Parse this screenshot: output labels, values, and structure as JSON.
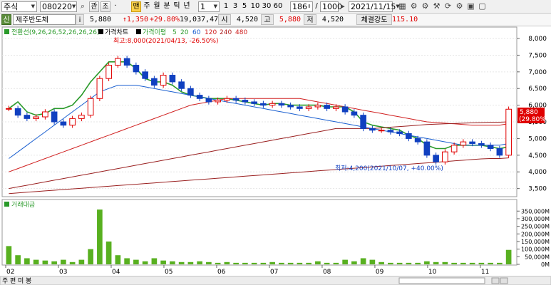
{
  "toolbar": {
    "market_select": "주식",
    "code_input": "080220",
    "btn_gwan": "관",
    "btn_jo": "조",
    "btn_yellow": "맨",
    "period_labels": [
      "주",
      "월",
      "분",
      "틱",
      "년"
    ],
    "interval_select": "1",
    "minute_buttons": [
      "1",
      "3",
      "5",
      "10",
      "30",
      "60"
    ],
    "count_input": "186",
    "total_input": "1000",
    "date_select": "2021/11/15"
  },
  "info": {
    "badge": "신",
    "name": "제주반도체",
    "info_icon": "i",
    "price": "5,880",
    "change": "↑1,350",
    "change_rate": "+29.80%",
    "volume": "19,037,471",
    "open_label": "시",
    "open": "4,520",
    "high_label": "고",
    "high": "5,880",
    "low_label": "저",
    "low": "4,520",
    "strength_label": "체결강도",
    "strength": "115.10"
  },
  "price_panel": {
    "legend_ichimoku": "전환선(9,26,26,52,26,26,26)",
    "legend_price": "가격차트",
    "legend_ma": "가격이평",
    "ma_periods": [
      "5",
      "20",
      "60",
      "120",
      "240",
      "480"
    ],
    "ma_colors": [
      "#2a9a2a",
      "#2a9a2a",
      "#1a5fd0",
      "#d02020",
      "#b02020",
      "#d02020"
    ],
    "high_annotation": "최고:8,000(2021/04/13, -26.50%)",
    "low_annotation": "최저:4,200(2021/10/07, +40.00%)",
    "last_price_tag": "5,880",
    "last_rate_tag": "(29.80%)",
    "y_ticks": [
      "8,000",
      "7,500",
      "7,000",
      "6,500",
      "6,000",
      "5,500",
      "5,000",
      "4,500",
      "4,000",
      "3,500"
    ]
  },
  "volume_panel": {
    "legend": "거래대금",
    "y_ticks": [
      "350,000M",
      "300,000M",
      "250,000M",
      "200,000M",
      "150,000M",
      "100,000M",
      "50,000M",
      "0M"
    ]
  },
  "x_axis": {
    "labels": [
      "02",
      "03",
      "04",
      "05",
      "06",
      "07",
      "08",
      "09",
      "10",
      "11"
    ]
  },
  "bottom_bar": {
    "tabs": [
      "주",
      "편",
      "미",
      "봉"
    ]
  },
  "colors": {
    "up": "#e00000",
    "down": "#1040c0",
    "conversion_line": "#2a9a2a",
    "ma60": "#1a5fd0",
    "ma120": "#d02020",
    "ma240": "#9a2020"
  },
  "chart_data": {
    "type": "candlestick",
    "x_labels": [
      "02",
      "03",
      "04",
      "05",
      "06",
      "07",
      "08",
      "09",
      "10",
      "11"
    ],
    "ylim": [
      3300,
      8300
    ],
    "close_path": [
      5900,
      5700,
      5600,
      5650,
      5800,
      5500,
      5400,
      5600,
      5700,
      6200,
      6800,
      7200,
      7400,
      7200,
      7000,
      6800,
      6600,
      6900,
      6700,
      6500,
      6300,
      6200,
      6100,
      6150,
      6200,
      6150,
      6100,
      6050,
      6000,
      6050,
      6000,
      5950,
      5900,
      5950,
      6000,
      5900,
      5950,
      5800,
      5700,
      5300,
      5250,
      5250,
      5200,
      5150,
      5000,
      4900,
      4500,
      4300,
      4600,
      4800,
      4900,
      4850,
      4800,
      4700,
      4500,
      5880
    ],
    "series": [
      {
        "name": "전환선",
        "values": [
          5900,
          6100,
          5800,
          5700,
          5750,
          5900,
          5900,
          6000,
          6300,
          6700,
          7000,
          7300,
          7300,
          7300,
          7100,
          6800,
          6700,
          6700,
          6600,
          6400,
          6300,
          6250,
          6200,
          6200,
          6200,
          6150,
          6100,
          6050,
          6000,
          6050,
          6050,
          6000,
          6000,
          6000,
          6000,
          5950,
          5950,
          5950,
          5800,
          5500,
          5400,
          5350,
          5300,
          5250,
          5100,
          5000,
          4800,
          4700,
          4700,
          4800,
          4800,
          4800,
          4800,
          4750,
          4700,
          4750
        ]
      },
      {
        "name": "60",
        "values": [
          4400,
          4600,
          4800,
          5000,
          5200,
          5400,
          5600,
          5800,
          6000,
          6200,
          6400,
          6500,
          6600,
          6600,
          6600,
          6550,
          6500,
          6450,
          6400,
          6350,
          6300,
          6250,
          6200,
          6150,
          6100,
          6050,
          6000,
          5950,
          5900,
          5850,
          5800,
          5750,
          5700,
          5650,
          5600,
          5550,
          5500,
          5450,
          5400,
          5350,
          5300,
          5250,
          5200,
          5150,
          5100,
          5050,
          5000,
          4950,
          4900,
          4850,
          4800,
          4800,
          4800,
          4800,
          4800,
          4850
        ]
      },
      {
        "name": "120",
        "values": [
          4000,
          4100,
          4200,
          4300,
          4400,
          4500,
          4600,
          4700,
          4800,
          4900,
          5000,
          5100,
          5200,
          5300,
          5400,
          5500,
          5600,
          5700,
          5800,
          5900,
          6000,
          6050,
          6100,
          6150,
          6200,
          6200,
          6200,
          6200,
          6200,
          6200,
          6200,
          6200,
          6200,
          6150,
          6100,
          6050,
          6000,
          5950,
          5900,
          5850,
          5800,
          5750,
          5700,
          5650,
          5600,
          5550,
          5500,
          5480,
          5460,
          5440,
          5420,
          5400,
          5400,
          5400,
          5400,
          5450
        ]
      },
      {
        "name": "240",
        "values": [
          3500,
          3550,
          3600,
          3650,
          3700,
          3750,
          3800,
          3850,
          3900,
          3950,
          4000,
          4050,
          4100,
          4150,
          4200,
          4250,
          4300,
          4350,
          4400,
          4450,
          4500,
          4550,
          4600,
          4650,
          4700,
          4750,
          4800,
          4850,
          4900,
          4950,
          5000,
          5050,
          5100,
          5150,
          5200,
          5250,
          5300,
          5300,
          5300,
          5300,
          5300,
          5320,
          5340,
          5360,
          5380,
          5400,
          5420,
          5430,
          5440,
          5450,
          5460,
          5470,
          5480,
          5490,
          5490,
          5500
        ]
      },
      {
        "name": "480",
        "values": [
          3350,
          3370,
          3390,
          3410,
          3430,
          3450,
          3470,
          3490,
          3510,
          3530,
          3550,
          3570,
          3590,
          3610,
          3630,
          3650,
          3670,
          3690,
          3710,
          3730,
          3750,
          3770,
          3790,
          3810,
          3830,
          3850,
          3870,
          3890,
          3910,
          3930,
          3950,
          3970,
          3990,
          4010,
          4030,
          4050,
          4070,
          4090,
          4110,
          4130,
          4150,
          4170,
          4190,
          4210,
          4230,
          4250,
          4270,
          4290,
          4310,
          4330,
          4350,
          4370,
          4390,
          4400,
          4400,
          4420
        ]
      }
    ],
    "volume_values_M": [
      120000,
      60000,
      40000,
      30000,
      25000,
      20000,
      30000,
      15000,
      30000,
      100000,
      360000,
      150000,
      60000,
      40000,
      30000,
      20000,
      40000,
      25000,
      20000,
      15000,
      15000,
      20000,
      15000,
      10000,
      15000,
      10000,
      10000,
      10000,
      10000,
      15000,
      10000,
      10000,
      10000,
      10000,
      20000,
      10000,
      10000,
      30000,
      20000,
      40000,
      30000,
      15000,
      10000,
      10000,
      10000,
      10000,
      20000,
      15000,
      15000,
      10000,
      10000,
      10000,
      10000,
      10000,
      10000,
      95000
    ],
    "volume_ylim": [
      0,
      370000
    ]
  }
}
